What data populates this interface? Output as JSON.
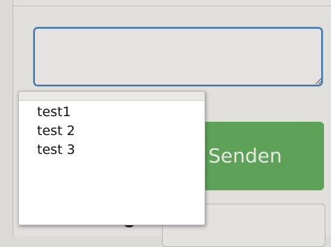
{
  "form": {
    "textarea_value": "",
    "submit_button_label": "Senden"
  },
  "dropdown": {
    "items": [
      "test1",
      "test 2",
      "test 3"
    ]
  },
  "colors": {
    "focus_border": "#3f74a8",
    "button_green": "#5ea25a"
  }
}
